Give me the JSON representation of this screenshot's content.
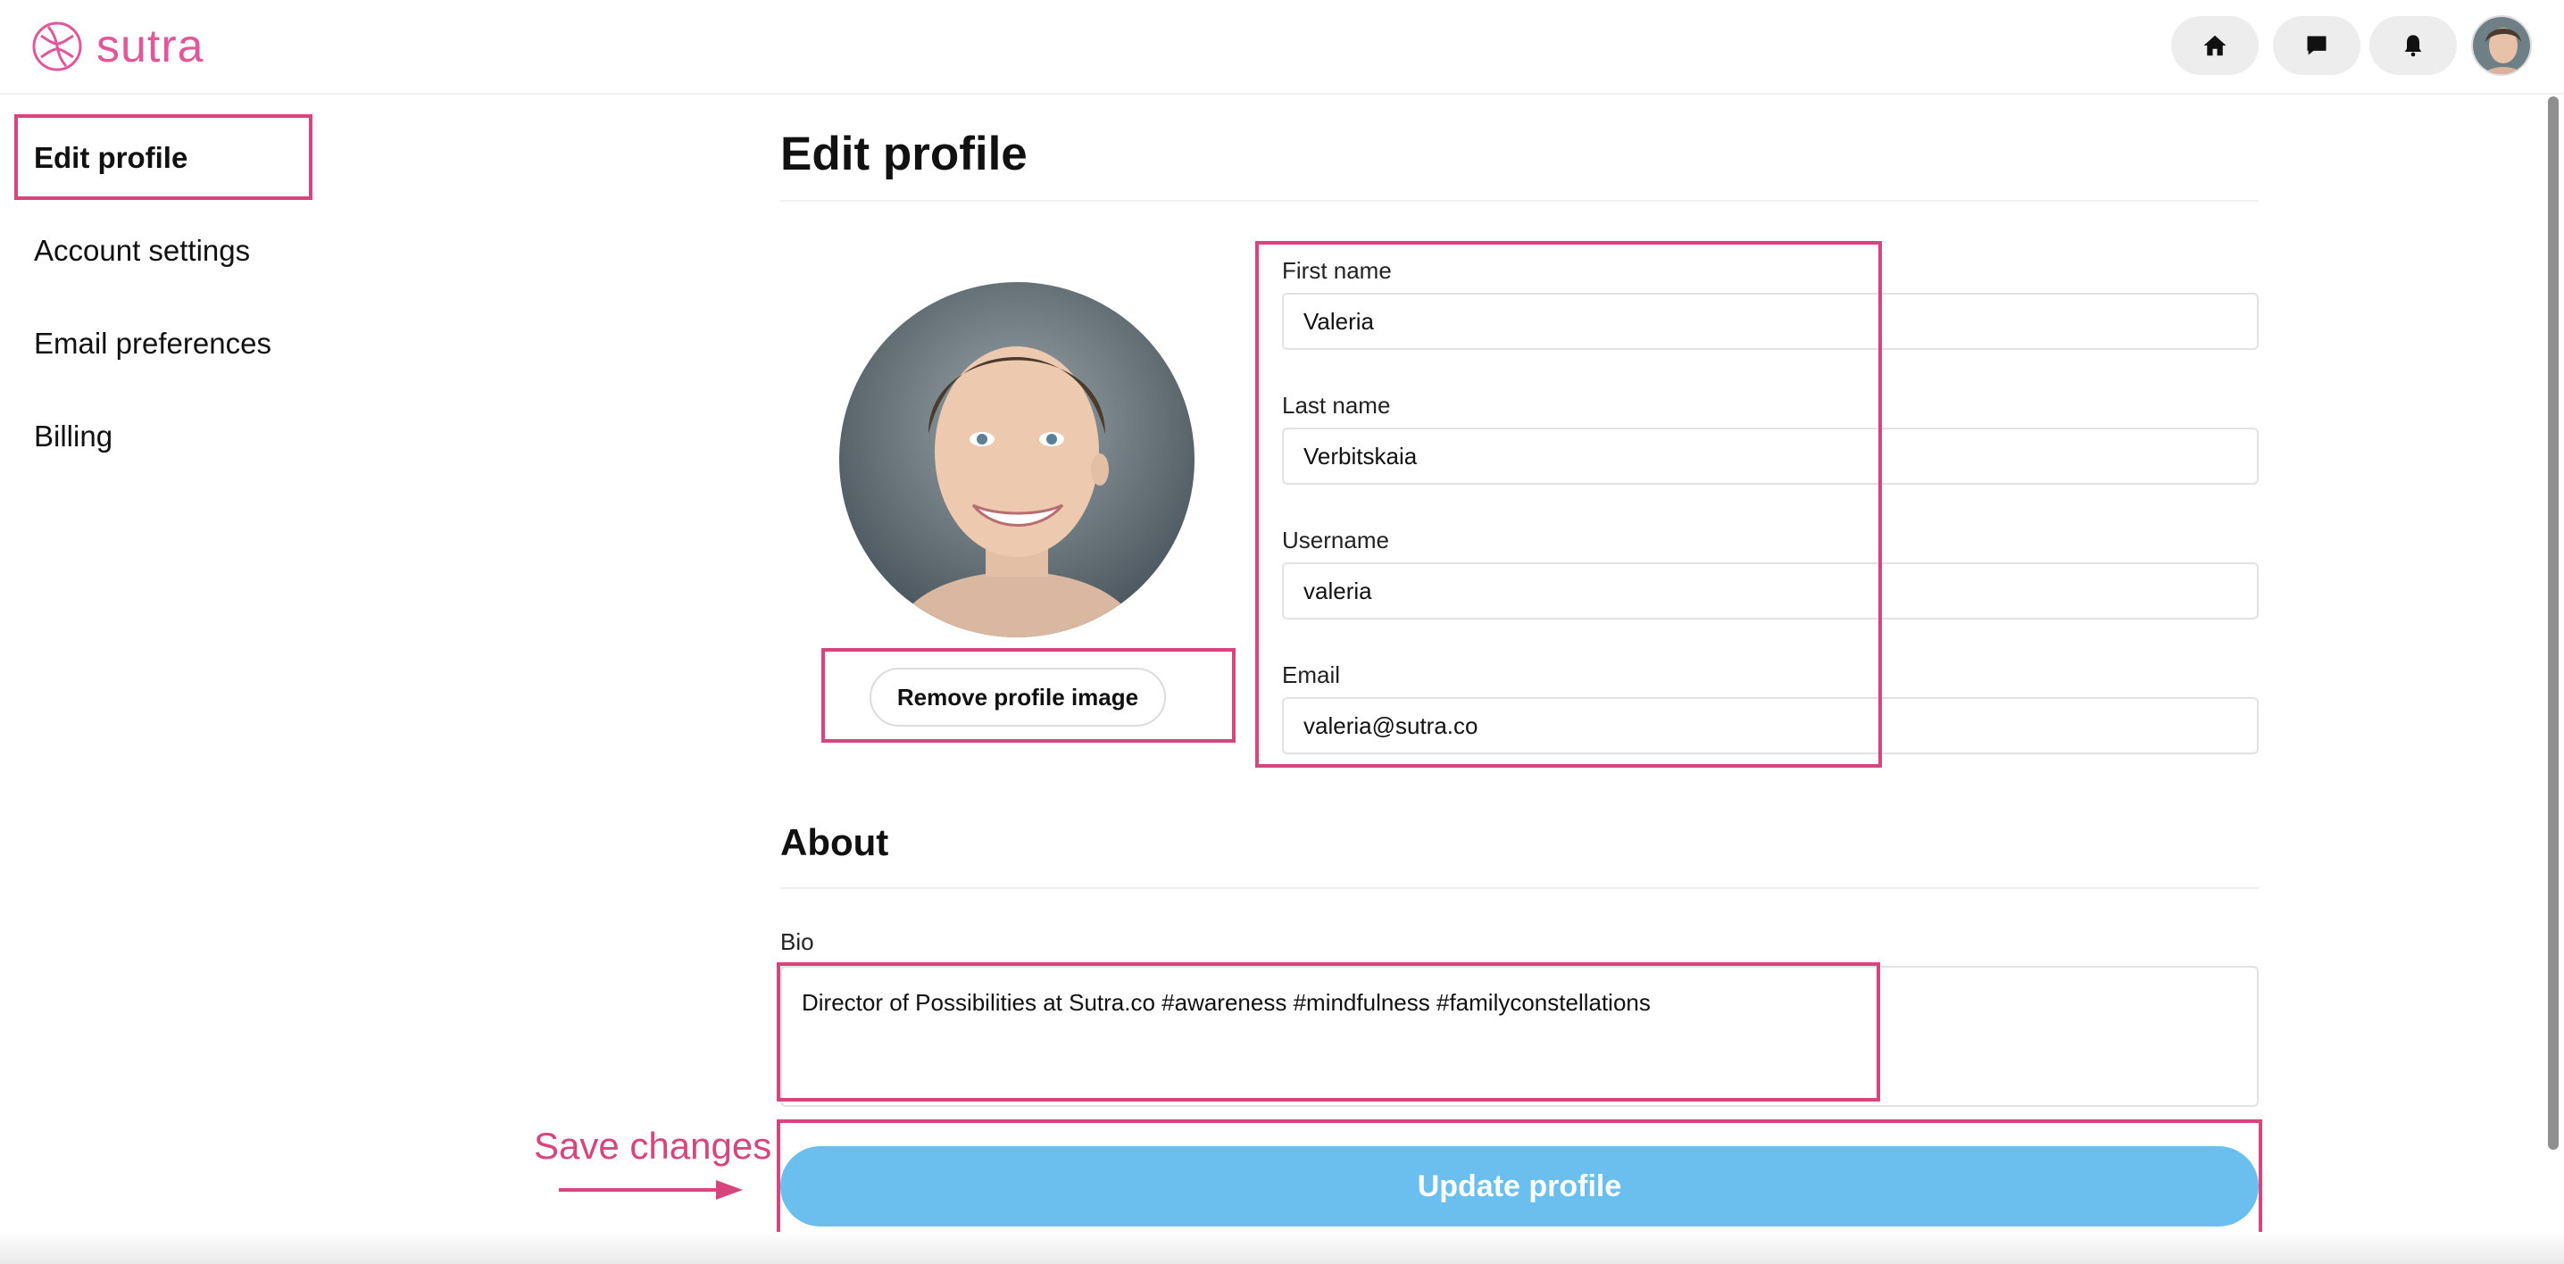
{
  "app": {
    "logo_text": "sutra",
    "brand_color": "#e0589a"
  },
  "header": {
    "icons": [
      "home-icon",
      "chat-icon",
      "bell-icon"
    ]
  },
  "sidebar": {
    "items": [
      {
        "label": "Edit profile",
        "active": true
      },
      {
        "label": "Account settings",
        "active": false
      },
      {
        "label": "Email preferences",
        "active": false
      },
      {
        "label": "Billing",
        "active": false
      }
    ]
  },
  "main": {
    "title": "Edit profile",
    "remove_image_label": "Remove profile image",
    "fields": [
      {
        "label": "First name",
        "value": "Valeria"
      },
      {
        "label": "Last name",
        "value": "Verbitskaia"
      },
      {
        "label": "Username",
        "value": "valeria"
      },
      {
        "label": "Email",
        "value": "valeria@sutra.co"
      }
    ],
    "about_title": "About",
    "bio_label": "Bio",
    "bio_value": "Director of Possibilities at Sutra.co #awareness #mindfulness #familyconstellations",
    "update_button": "Update profile",
    "button_color": "#6bbfee"
  },
  "annotations": {
    "save_note": "Save changes",
    "highlight_color": "#d6457e"
  }
}
